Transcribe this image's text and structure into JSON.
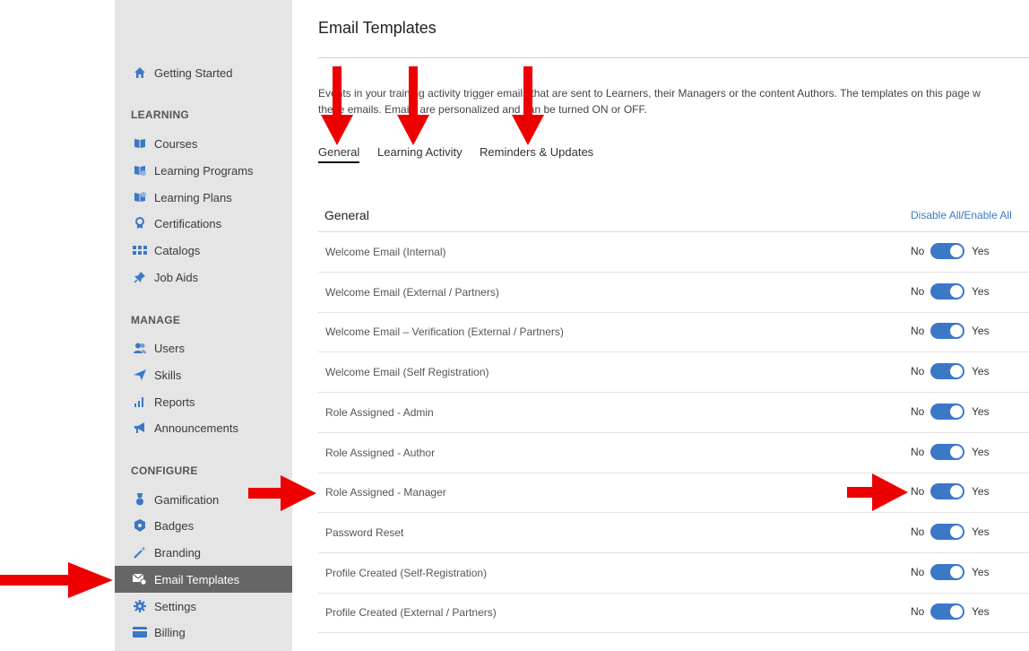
{
  "sidebar": {
    "getting_started": {
      "label": "Getting Started",
      "icon": "home-icon"
    },
    "sections": [
      {
        "heading": "LEARNING"
      },
      {
        "heading": "MANAGE"
      },
      {
        "heading": "CONFIGURE"
      }
    ],
    "items": [
      {
        "label": "Courses",
        "icon": "book-icon"
      },
      {
        "label": "Learning Programs",
        "icon": "program-icon"
      },
      {
        "label": "Learning Plans",
        "icon": "plan-icon"
      },
      {
        "label": "Certifications",
        "icon": "certificate-icon"
      },
      {
        "label": "Catalogs",
        "icon": "catalog-icon"
      },
      {
        "label": "Job Aids",
        "icon": "pin-icon"
      },
      {
        "label": "Users",
        "icon": "users-icon"
      },
      {
        "label": "Skills",
        "icon": "paper-plane-icon"
      },
      {
        "label": "Reports",
        "icon": "bar-chart-icon"
      },
      {
        "label": "Announcements",
        "icon": "megaphone-icon"
      },
      {
        "label": "Gamification",
        "icon": "medal-icon"
      },
      {
        "label": "Badges",
        "icon": "badge-icon"
      },
      {
        "label": "Branding",
        "icon": "wand-icon"
      },
      {
        "label": "Email Templates",
        "icon": "email-settings-icon"
      },
      {
        "label": "Settings",
        "icon": "gear-icon"
      },
      {
        "label": "Billing",
        "icon": "credit-card-icon"
      }
    ]
  },
  "main": {
    "title": "Email Templates",
    "description_line1": "Events in your training activity trigger emails that are sent to Learners, their Managers or the content Authors. The templates on this page w",
    "description_line2": "these emails. Emails are personalized and can be turned ON or OFF.",
    "tabs": [
      {
        "label": "General",
        "active": true
      },
      {
        "label": "Learning Activity",
        "active": false
      },
      {
        "label": "Reminders & Updates",
        "active": false
      }
    ],
    "section_title": "General",
    "disable_all": "Disable All",
    "separator": "/",
    "enable_all": "Enable All",
    "no_label": "No",
    "yes_label": "Yes",
    "rows": [
      {
        "label": "Welcome Email (Internal)",
        "enabled": true
      },
      {
        "label": "Welcome Email (External / Partners)",
        "enabled": true
      },
      {
        "label": "Welcome Email – Verification (External / Partners)",
        "enabled": true
      },
      {
        "label": "Welcome Email (Self Registration)",
        "enabled": true
      },
      {
        "label": "Role Assigned - Admin",
        "enabled": true
      },
      {
        "label": "Role Assigned - Author",
        "enabled": true
      },
      {
        "label": "Role Assigned - Manager",
        "enabled": true
      },
      {
        "label": "Password Reset",
        "enabled": true
      },
      {
        "label": "Profile Created (Self-Registration)",
        "enabled": true
      },
      {
        "label": "Profile Created (External / Partners)",
        "enabled": true
      }
    ]
  },
  "colors": {
    "accent": "#3b78c6",
    "annotation": "#ee0000",
    "active_sidebar": "#666666"
  }
}
